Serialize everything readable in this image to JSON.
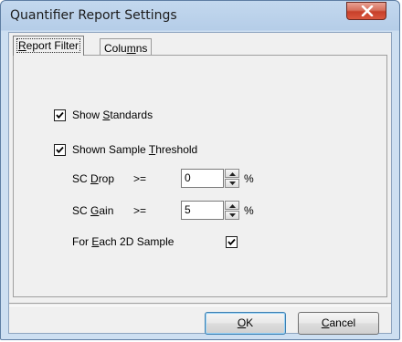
{
  "window": {
    "title": "Quantifier Report Settings"
  },
  "tabs": [
    {
      "pre": "",
      "u": "R",
      "post": "eport Filter",
      "active": true
    },
    {
      "pre": "Colu",
      "u": "m",
      "post": "ns",
      "active": false
    }
  ],
  "options": {
    "show_standards": {
      "pre": "Show ",
      "u": "S",
      "post": "tandards",
      "checked": true
    },
    "shown_sample_threshold": {
      "pre": "Shown Sample ",
      "u": "T",
      "post": "hreshold",
      "checked": true
    }
  },
  "sc_drop": {
    "pre": "SC ",
    "u": "D",
    "post": "rop",
    "op": ">=",
    "value": "0",
    "unit": "%"
  },
  "sc_gain": {
    "pre": "SC ",
    "u": "G",
    "post": "ain",
    "op": ">=",
    "value": "5",
    "unit": "%"
  },
  "for_each": {
    "pre": "For ",
    "u": "E",
    "post": "ach 2D Sample",
    "checked": true
  },
  "buttons": {
    "ok": {
      "pre": "",
      "u": "O",
      "post": "K"
    },
    "cancel": {
      "pre": "",
      "u": "C",
      "post": "ancel"
    }
  },
  "icons": {
    "close": "close-icon",
    "check": "checkmark-icon",
    "spin_up": "arrow-up-icon",
    "spin_down": "arrow-down-icon"
  }
}
